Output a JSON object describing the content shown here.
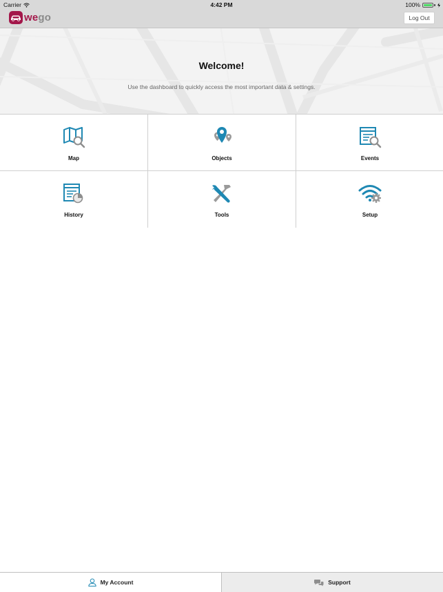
{
  "status_bar": {
    "carrier": "Carrier",
    "time": "4:42 PM",
    "battery_percent": "100%"
  },
  "header": {
    "logo_text_a": "we",
    "logo_text_b": "go",
    "logout_label": "Log Out"
  },
  "hero": {
    "title": "Welcome!",
    "subtitle": "Use the dashboard to quickly access the most important data & settings."
  },
  "tiles": [
    {
      "label": "Map",
      "icon": "map-icon"
    },
    {
      "label": "Objects",
      "icon": "objects-icon"
    },
    {
      "label": "Events",
      "icon": "events-icon"
    },
    {
      "label": "History",
      "icon": "history-icon"
    },
    {
      "label": "Tools",
      "icon": "tools-icon"
    },
    {
      "label": "Setup",
      "icon": "setup-icon"
    }
  ],
  "tabbar": {
    "account_label": "My Account",
    "support_label": "Support"
  },
  "colors": {
    "brand": "#a3174a",
    "accent_blue": "#1e88b3",
    "icon_gray": "#8e8e8e"
  }
}
